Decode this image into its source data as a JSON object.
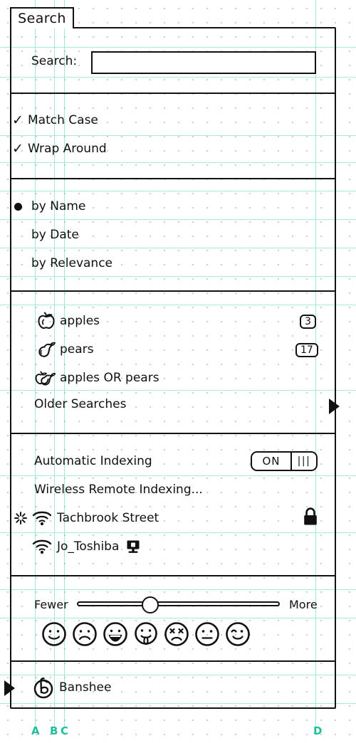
{
  "window": {
    "tab_label": "Search"
  },
  "search": {
    "label": "Search:",
    "value": "",
    "placeholder": ""
  },
  "options": {
    "items": [
      {
        "label": "Match Case",
        "checked": true,
        "icon": "check-icon"
      },
      {
        "label": "Wrap Around",
        "checked": true,
        "icon": "check-icon"
      }
    ]
  },
  "sort": {
    "items": [
      {
        "label": "by Name",
        "selected": true
      },
      {
        "label": "by Date",
        "selected": false
      },
      {
        "label": "by Relevance",
        "selected": false
      }
    ]
  },
  "saved_searches": {
    "items": [
      {
        "label": "apples",
        "icon": "apple-icon",
        "badge": "3"
      },
      {
        "label": "pears",
        "icon": "pear-icon",
        "badge": "17"
      },
      {
        "label": "apples OR pears",
        "icon": "apple-pear-icon",
        "badge": ""
      },
      {
        "label": "Older Searches",
        "icon": "",
        "badge": "",
        "disclosure": "right-triangle-icon"
      }
    ]
  },
  "indexing": {
    "automatic": {
      "label": "Automatic Indexing",
      "toggle_state": "ON",
      "grip": "|||"
    },
    "remote_label": "Wireless Remote Indexing...",
    "networks": [
      {
        "name": "Tachbrook Street",
        "icon": "wifi-icon",
        "activity": "activity-icon",
        "trailing": "lock-icon"
      },
      {
        "name": "Jo_Toshiba",
        "icon": "wifi-icon",
        "activity": "",
        "trailing": "computer-icon"
      }
    ]
  },
  "results_slider": {
    "min_label": "Fewer",
    "max_label": "More",
    "value_percent": 36,
    "faces": [
      "smile-face",
      "sad-face",
      "grin-face",
      "tongue-face",
      "angry-face",
      "neutral-face",
      "wink-face"
    ]
  },
  "footer_item": {
    "label": "Banshee",
    "icon": "banshee-icon",
    "disclosure": "right-triangle-icon"
  },
  "guides": {
    "markers": [
      "A",
      "B",
      "C",
      "D"
    ]
  },
  "colors": {
    "ink": "#111111",
    "guide": "#57d7bd",
    "marker": "#1fbf9c",
    "paper": "#ffffff"
  }
}
